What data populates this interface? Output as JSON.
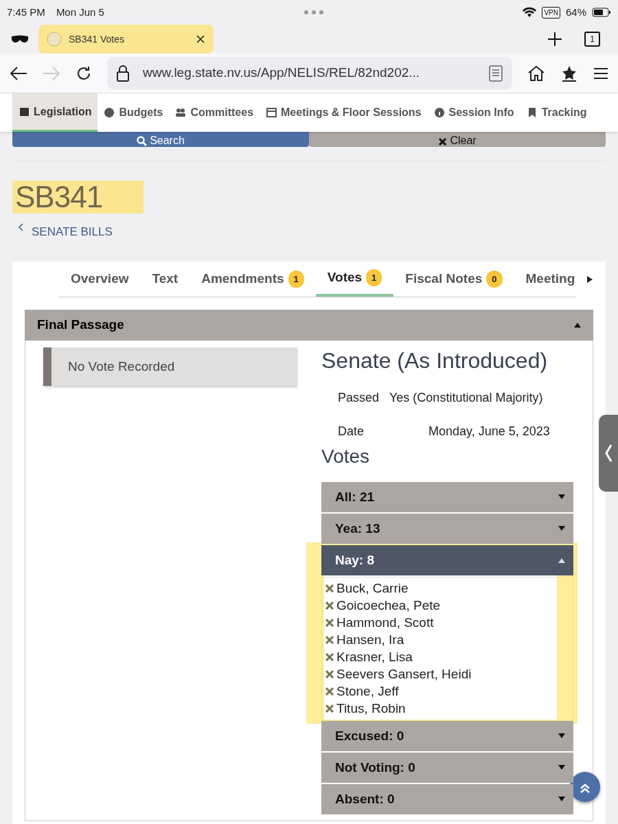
{
  "status_bar": {
    "time": "7:45 PM",
    "date": "Mon Jun 5",
    "vpn": "VPN",
    "battery": "64%"
  },
  "browser_tab": {
    "title": "SB341 Votes",
    "highlighted": true,
    "tab_count": "1"
  },
  "address_bar": {
    "url": "www.leg.state.nv.us/App/NELIS/REL/82nd202..."
  },
  "site_nav": [
    {
      "label": "Legislation",
      "selected": true
    },
    {
      "label": "Budgets",
      "selected": false
    },
    {
      "label": "Committees",
      "selected": false
    },
    {
      "label": "Meetings & Floor Sessions",
      "selected": false
    },
    {
      "label": "Session Info",
      "selected": false
    },
    {
      "label": "Tracking",
      "selected": false
    }
  ],
  "search_buttons": [
    "Search",
    "Clear"
  ],
  "page": {
    "title": "SB341",
    "title_highlighted": true,
    "back_link": "SENATE BILLS"
  },
  "bill_tabs": [
    {
      "label": "Overview",
      "selected": false
    },
    {
      "label": "Text",
      "selected": false
    },
    {
      "label": "Amendments",
      "count": "1",
      "selected": false
    },
    {
      "label": "Votes",
      "count": "1",
      "selected": true
    },
    {
      "label": "Fiscal Notes",
      "count": "0",
      "selected": false
    },
    {
      "label": "Meeting",
      "selected": false
    }
  ],
  "section": {
    "title": "Final Passage",
    "expanded": true,
    "no_vote": "No Vote Recorded",
    "vote_title": "Senate (As Introduced)",
    "fields": [
      {
        "label": "Passed",
        "value": "Yes (Constitutional Majority)"
      },
      {
        "label": "Date",
        "value": "Monday, June 5, 2023"
      }
    ],
    "votes_heading": "Votes",
    "vote_groups": [
      {
        "label": "All: 21",
        "expanded": false,
        "highlighted": false
      },
      {
        "label": "Yea: 13",
        "expanded": false,
        "highlighted": false
      },
      {
        "label": "Nay: 8",
        "expanded": true,
        "highlighted": true,
        "members": [
          "Buck, Carrie",
          "Goicoechea, Pete",
          "Hammond, Scott",
          "Hansen, Ira",
          "Krasner, Lisa",
          "Seevers Gansert, Heidi",
          "Stone, Jeff",
          "Titus, Robin"
        ]
      },
      {
        "label": "Excused: 0",
        "expanded": false,
        "highlighted": false
      },
      {
        "label": "Not Voting: 0",
        "expanded": false,
        "highlighted": false
      },
      {
        "label": "Absent: 0",
        "expanded": false,
        "highlighted": false
      }
    ]
  }
}
